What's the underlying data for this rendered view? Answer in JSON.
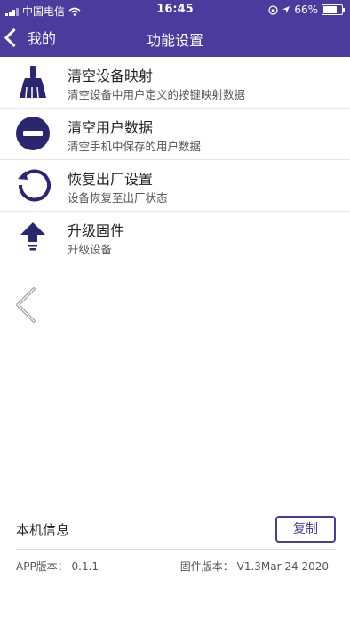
{
  "status": {
    "carrier": "中国电信",
    "time": "16:45",
    "battery": "66%"
  },
  "nav": {
    "back_label": "我的",
    "title": "功能设置"
  },
  "items": [
    {
      "title": "清空设备映射",
      "subtitle": "清空设备中用户定义的按键映射数据",
      "icon": "broom-icon"
    },
    {
      "title": "清空用户数据",
      "subtitle": "清空手机中保存的用户数据",
      "icon": "minus-circle-icon"
    },
    {
      "title": "恢复出厂设置",
      "subtitle": "设备恢复至出厂状态",
      "icon": "restore-icon"
    },
    {
      "title": "升级固件",
      "subtitle": "升级设备",
      "icon": "upgrade-arrow-icon"
    }
  ],
  "info": {
    "label": "本机信息",
    "copy_label": "复制",
    "app_version_label": "APP版本：",
    "app_version": "0.1.1",
    "firmware_label": "固件版本：",
    "firmware_version": "V1.3Mar 24 2020"
  },
  "colors": {
    "accent": "#4b3b9d",
    "icon": "#2a2670"
  }
}
